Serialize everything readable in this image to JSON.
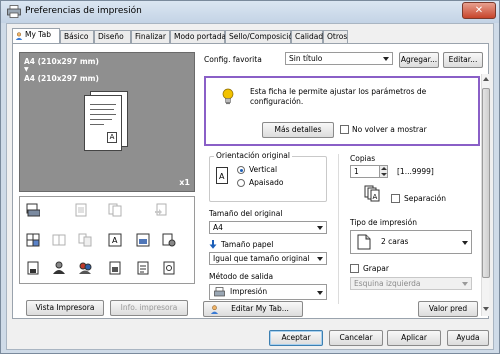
{
  "window": {
    "title": "Preferencias de impresión",
    "close_glyph": "✕"
  },
  "tabs": [
    "My Tab",
    "Básico",
    "Diseño",
    "Finalizar",
    "Modo portada",
    "Sello/Composición",
    "Calidad",
    "Otros"
  ],
  "preview": {
    "size_from": "A4 (210x297 mm)",
    "arrow": "▼",
    "size_to": "A4 (210x297 mm)",
    "copies_label": "x1",
    "page_letter": "A"
  },
  "left_buttons": {
    "printer_view": "Vista Impresora",
    "printer_info": "Info. impresora"
  },
  "favorite": {
    "label": "Config. favorita",
    "value": "Sin título",
    "add": "Agregar...",
    "edit": "Editar..."
  },
  "info": {
    "message_line1": "Esta ficha le permite ajustar los parámetros de",
    "message_line2": "configuración.",
    "details_button": "Más detalles",
    "dont_show": "No volver a mostrar"
  },
  "orientation": {
    "legend": "Orientación original",
    "vertical": "Vertical",
    "horizontal": "Apaisado",
    "selected": "Vertical"
  },
  "original_size": {
    "label": "Tamaño del original",
    "value": "A4"
  },
  "paper_size": {
    "label": "Tamaño papel",
    "value": "Igual que tamaño original"
  },
  "output_method": {
    "label": "Método de salida",
    "value": "Impresión"
  },
  "copies": {
    "label": "Copias",
    "value": "1",
    "range": "[1...9999]"
  },
  "collate": {
    "label": "Separación",
    "checked": false
  },
  "print_type": {
    "label": "Tipo de impresión",
    "value": "2 caras"
  },
  "staple": {
    "label": "Grapar",
    "position": "Esquina izquierda",
    "checked": false
  },
  "edit_my_tab": "Editar My Tab...",
  "defaults_button": "Valor pred",
  "footer": {
    "ok": "Aceptar",
    "cancel": "Cancelar",
    "apply": "Aplicar",
    "help": "Ayuda"
  },
  "colors": {
    "accent_border": "#8a5fc7",
    "bulb": "#f2c200",
    "arrow_blue": "#1d5fb8"
  }
}
